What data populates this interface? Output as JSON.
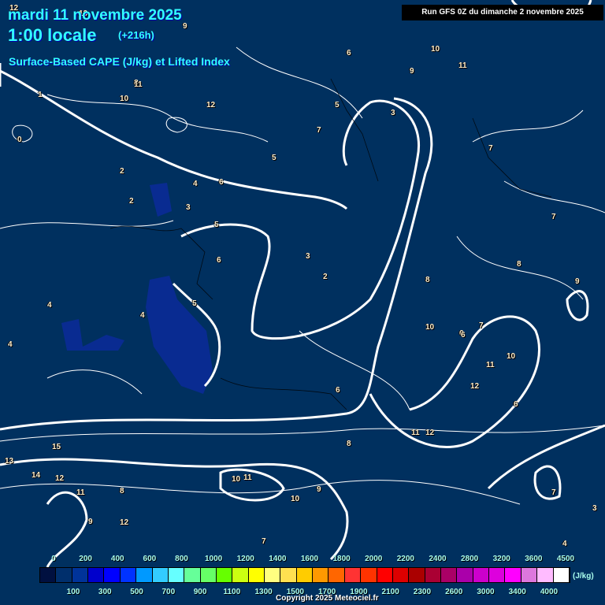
{
  "header": {
    "date": "mardi 11 novembre 2025",
    "time": "1:00 locale",
    "lead": "(+216h)",
    "product": "Surface-Based CAPE (J/kg) et Lifted Index",
    "run": "Run GFS 0Z du dimanche 2 novembre 2025"
  },
  "legend": {
    "unit": "(J/kg)",
    "top_ticks": [
      "0",
      "200",
      "400",
      "600",
      "800",
      "1000",
      "1200",
      "1400",
      "1600",
      "1800",
      "2000",
      "2200",
      "2400",
      "2800",
      "3200",
      "3600",
      "4500"
    ],
    "bottom_ticks": [
      "100",
      "300",
      "500",
      "700",
      "900",
      "1100",
      "1300",
      "1500",
      "1700",
      "1900",
      "2100",
      "2300",
      "2600",
      "3000",
      "3400",
      "4000"
    ],
    "colors": [
      "#001040",
      "#002f6c",
      "#003399",
      "#0000cc",
      "#0000ff",
      "#0033ff",
      "#0099ff",
      "#33ccff",
      "#66ffff",
      "#66ff99",
      "#66ff66",
      "#66ff00",
      "#ccff11",
      "#ffff00",
      "#ffff80",
      "#ffe050",
      "#ffcc00",
      "#ff9900",
      "#ff6600",
      "#ff3333",
      "#ff3300",
      "#ff0000",
      "#dd0000",
      "#aa0000",
      "#aa0033",
      "#aa0066",
      "#aa00aa",
      "#cc00cc",
      "#dd00dd",
      "#ff00ff",
      "#dd77dd",
      "#ffbbff",
      "#ffffff"
    ]
  },
  "contour_labels": [
    "12",
    "13",
    "9",
    "6",
    "10",
    "9",
    "8",
    "11",
    "5",
    "11",
    "10",
    "12",
    "7",
    "3",
    "2",
    "0",
    "1",
    "6",
    "2",
    "4",
    "3",
    "5",
    "6",
    "3",
    "2",
    "4",
    "5",
    "4",
    "4",
    "8",
    "10",
    "6",
    "7",
    "11",
    "10",
    "12",
    "11",
    "12",
    "6",
    "15",
    "13",
    "14",
    "12",
    "11",
    "8",
    "10",
    "11",
    "9",
    "9",
    "12",
    "7",
    "6",
    "8",
    "7",
    "10",
    "3",
    "4",
    "7",
    "8",
    "9",
    "7",
    "6",
    "5"
  ],
  "copyright": "Copyright 2025 Meteociel.fr"
}
